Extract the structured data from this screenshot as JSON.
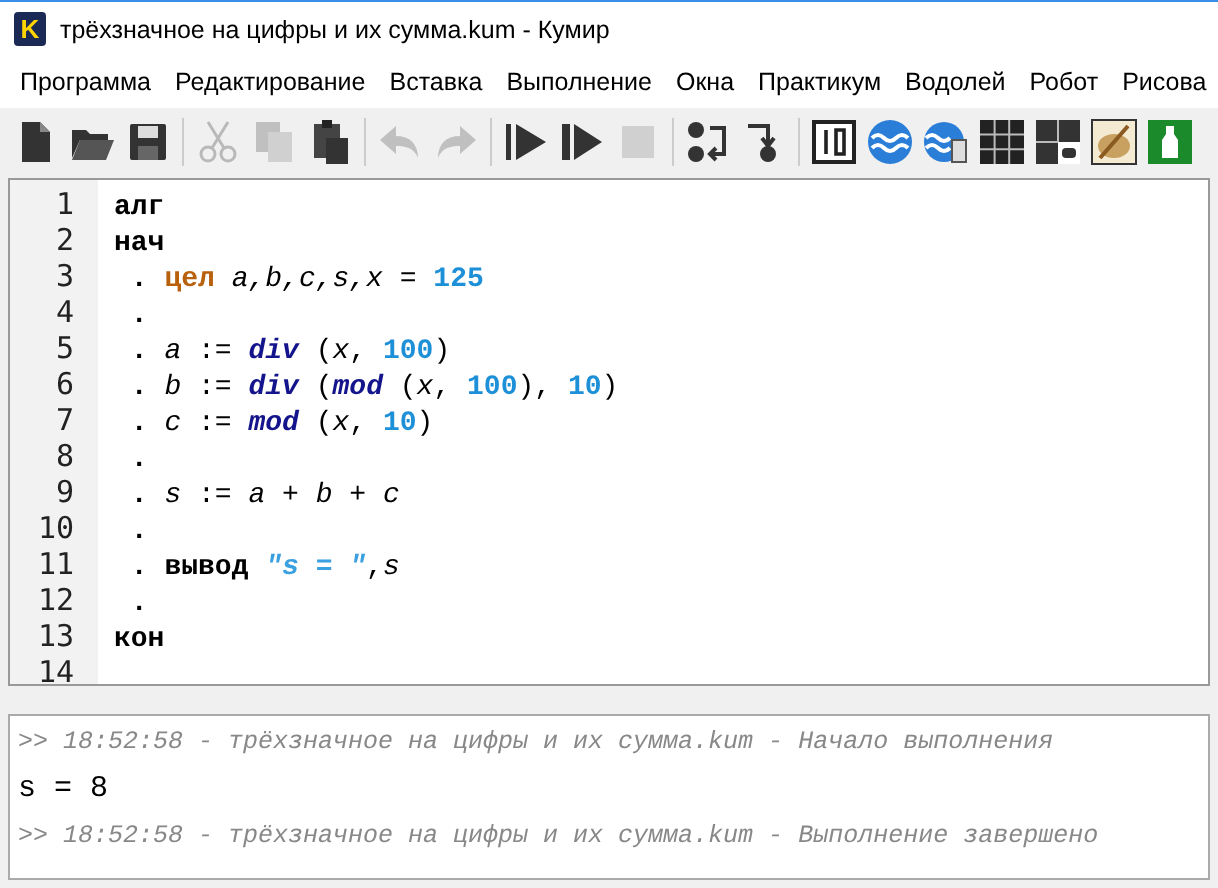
{
  "window": {
    "logo_letter": "K",
    "title": "трёхзначное на цифры и их сумма.kum - Кумир"
  },
  "menu": [
    "Программа",
    "Редактирование",
    "Вставка",
    "Выполнение",
    "Окна",
    "Практикум",
    "Водолей",
    "Робот",
    "Рисова"
  ],
  "toolbar": [
    {
      "kind": "new",
      "disabled": false
    },
    {
      "kind": "open",
      "disabled": false
    },
    {
      "kind": "save",
      "disabled": false
    },
    {
      "kind": "separator"
    },
    {
      "kind": "cut",
      "disabled": true
    },
    {
      "kind": "copy",
      "disabled": true
    },
    {
      "kind": "paste",
      "disabled": false
    },
    {
      "kind": "separator"
    },
    {
      "kind": "undo",
      "disabled": true
    },
    {
      "kind": "redo",
      "disabled": true
    },
    {
      "kind": "separator"
    },
    {
      "kind": "run",
      "disabled": false
    },
    {
      "kind": "step",
      "disabled": false
    },
    {
      "kind": "stop",
      "disabled": true
    },
    {
      "kind": "separator"
    },
    {
      "kind": "step-in",
      "disabled": false
    },
    {
      "kind": "step-out",
      "disabled": false
    },
    {
      "kind": "separator"
    },
    {
      "kind": "display",
      "disabled": false
    },
    {
      "kind": "waves",
      "disabled": false
    },
    {
      "kind": "waves-tank",
      "disabled": false
    },
    {
      "kind": "grid",
      "disabled": false
    },
    {
      "kind": "robot",
      "disabled": false
    },
    {
      "kind": "palette",
      "disabled": false
    },
    {
      "kind": "bottle",
      "disabled": false
    }
  ],
  "editor": {
    "lines": [
      {
        "number": "1",
        "tokens": [
          {
            "kind": "keyword",
            "text": "алг"
          }
        ]
      },
      {
        "number": "2",
        "tokens": [
          {
            "kind": "keyword",
            "text": "нач"
          }
        ]
      },
      {
        "number": "3",
        "tokens": [
          {
            "kind": "dot",
            "text": " . "
          },
          {
            "kind": "type",
            "text": "цел"
          },
          {
            "kind": "var",
            "text": " a,b,c,s,x"
          },
          {
            "kind": "op",
            "text": " = "
          },
          {
            "kind": "number",
            "text": "125"
          }
        ]
      },
      {
        "number": "4",
        "tokens": [
          {
            "kind": "dot",
            "text": " ."
          }
        ]
      },
      {
        "number": "5",
        "tokens": [
          {
            "kind": "dot",
            "text": " . "
          },
          {
            "kind": "var",
            "text": "a"
          },
          {
            "kind": "op",
            "text": " := "
          },
          {
            "kind": "func",
            "text": "div"
          },
          {
            "kind": "op",
            "text": " ("
          },
          {
            "kind": "var",
            "text": "x"
          },
          {
            "kind": "op",
            "text": ", "
          },
          {
            "kind": "number",
            "text": "100"
          },
          {
            "kind": "op",
            "text": ")"
          }
        ]
      },
      {
        "number": "6",
        "tokens": [
          {
            "kind": "dot",
            "text": " . "
          },
          {
            "kind": "var",
            "text": "b"
          },
          {
            "kind": "op",
            "text": " := "
          },
          {
            "kind": "func",
            "text": "div"
          },
          {
            "kind": "op",
            "text": " ("
          },
          {
            "kind": "func",
            "text": "mod"
          },
          {
            "kind": "op",
            "text": " ("
          },
          {
            "kind": "var",
            "text": "x"
          },
          {
            "kind": "op",
            "text": ", "
          },
          {
            "kind": "number",
            "text": "100"
          },
          {
            "kind": "op",
            "text": "), "
          },
          {
            "kind": "number",
            "text": "10"
          },
          {
            "kind": "op",
            "text": ")"
          }
        ]
      },
      {
        "number": "7",
        "tokens": [
          {
            "kind": "dot",
            "text": " . "
          },
          {
            "kind": "var",
            "text": "c"
          },
          {
            "kind": "op",
            "text": " := "
          },
          {
            "kind": "func",
            "text": "mod"
          },
          {
            "kind": "op",
            "text": " ("
          },
          {
            "kind": "var",
            "text": "x"
          },
          {
            "kind": "op",
            "text": ", "
          },
          {
            "kind": "number",
            "text": "10"
          },
          {
            "kind": "op",
            "text": ")"
          }
        ]
      },
      {
        "number": "8",
        "tokens": [
          {
            "kind": "dot",
            "text": " ."
          }
        ]
      },
      {
        "number": "9",
        "tokens": [
          {
            "kind": "dot",
            "text": " . "
          },
          {
            "kind": "var",
            "text": "s"
          },
          {
            "kind": "op",
            "text": " := "
          },
          {
            "kind": "var",
            "text": "a"
          },
          {
            "kind": "op",
            "text": " + "
          },
          {
            "kind": "var",
            "text": "b"
          },
          {
            "kind": "op",
            "text": " + "
          },
          {
            "kind": "var",
            "text": "c"
          }
        ]
      },
      {
        "number": "10",
        "tokens": [
          {
            "kind": "dot",
            "text": " ."
          }
        ]
      },
      {
        "number": "11",
        "tokens": [
          {
            "kind": "dot",
            "text": " . "
          },
          {
            "kind": "keyword",
            "text": "вывод"
          },
          {
            "kind": "string",
            "text": " \"s = \""
          },
          {
            "kind": "op",
            "text": ","
          },
          {
            "kind": "var",
            "text": "s"
          }
        ]
      },
      {
        "number": "12",
        "tokens": [
          {
            "kind": "dot",
            "text": " ."
          }
        ]
      },
      {
        "number": "13",
        "tokens": [
          {
            "kind": "keyword",
            "text": "кон"
          }
        ]
      },
      {
        "number": "14"
      }
    ]
  },
  "console": [
    {
      "kind": "info",
      "text": ">> 18:52:58 - трёхзначное на цифры и их сумма.kum - Начало выполнения"
    },
    {
      "kind": "output",
      "text": "s = 8"
    },
    {
      "kind": "info",
      "text": ">> 18:52:58 - трёхзначное на цифры и их сумма.kum - Выполнение завершено"
    }
  ]
}
